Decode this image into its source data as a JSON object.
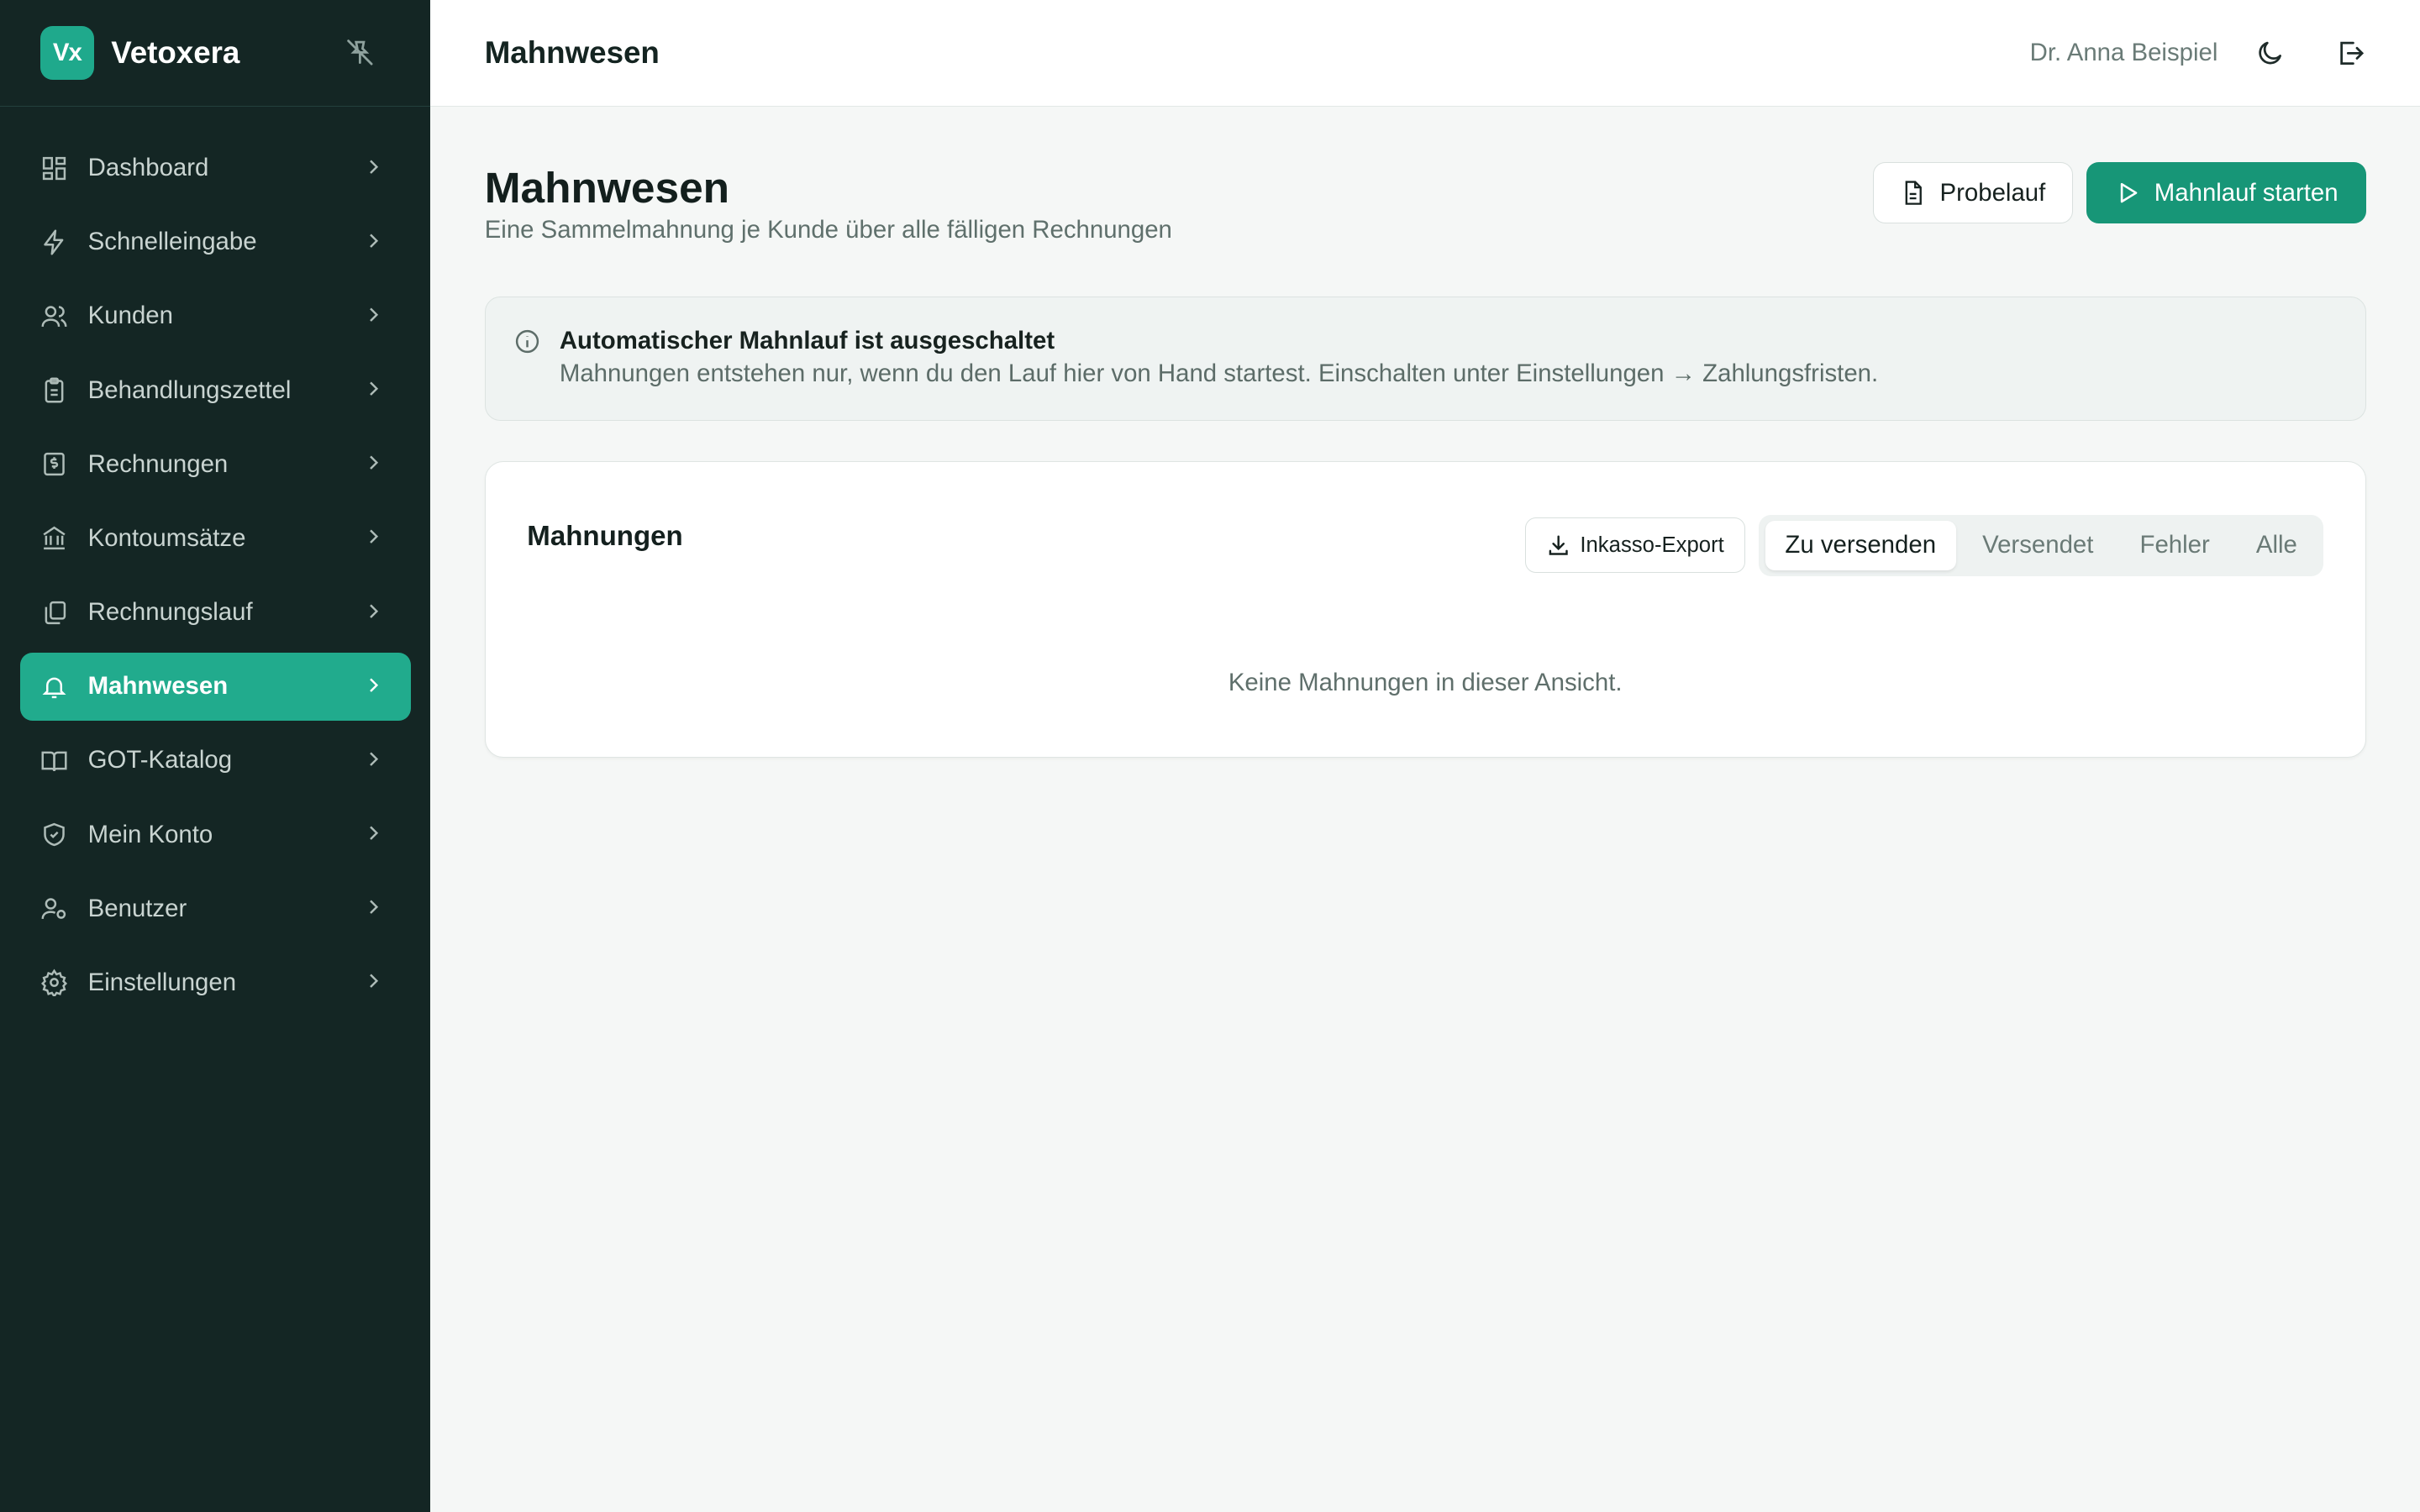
{
  "brand": {
    "logo_text": "Vx",
    "name": "Vetoxera"
  },
  "sidebar": {
    "items": [
      {
        "label": "Dashboard",
        "icon": "dashboard-icon"
      },
      {
        "label": "Schnelleingabe",
        "icon": "lightning-icon"
      },
      {
        "label": "Kunden",
        "icon": "users-icon"
      },
      {
        "label": "Behandlungszettel",
        "icon": "clipboard-icon"
      },
      {
        "label": "Rechnungen",
        "icon": "invoice-icon"
      },
      {
        "label": "Kontoumsätze",
        "icon": "bank-icon"
      },
      {
        "label": "Rechnungslauf",
        "icon": "copy-icon"
      },
      {
        "label": "Mahnwesen",
        "icon": "bell-icon",
        "active": true
      },
      {
        "label": "GOT-Katalog",
        "icon": "book-icon"
      },
      {
        "label": "Mein Konto",
        "icon": "shield-icon"
      },
      {
        "label": "Benutzer",
        "icon": "user-cog-icon"
      },
      {
        "label": "Einstellungen",
        "icon": "gear-icon"
      }
    ]
  },
  "topbar": {
    "title": "Mahnwesen",
    "user": "Dr. Anna Beispiel"
  },
  "page": {
    "title": "Mahnwesen",
    "subtitle": "Eine Sammelmahnung je Kunde über alle fälligen Rechnungen",
    "btn_dry_run": "Probelauf",
    "btn_start": "Mahnlauf starten"
  },
  "info": {
    "title": "Automatischer Mahnlauf ist ausgeschaltet",
    "text": "Mahnungen entstehen nur, wenn du den Lauf hier von Hand startest. Einschalten unter Einstellungen → Zahlungsfristen."
  },
  "card": {
    "title": "Mahnungen",
    "export_label": "Inkasso-Export",
    "tabs": [
      "Zu versenden",
      "Versendet",
      "Fehler",
      "Alle"
    ],
    "empty": "Keine Mahnungen in dieser Ansicht."
  },
  "colors": {
    "sidebar_bg": "#142624",
    "accent": "#21ab8d",
    "primary_button": "#179677"
  }
}
